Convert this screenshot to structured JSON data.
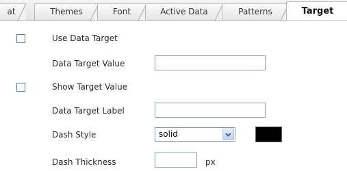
{
  "tabs": [
    {
      "label": "at"
    },
    {
      "label": "Themes"
    },
    {
      "label": "Font"
    },
    {
      "label": "Active Data"
    },
    {
      "label": "Patterns"
    },
    {
      "label": "Target"
    }
  ],
  "active_tab": "Target",
  "form": {
    "use_data_target": {
      "label": "Use Data Target",
      "checked": false
    },
    "data_target_value": {
      "label": "Data Target Value",
      "value": ""
    },
    "show_target_value": {
      "label": "Show Target Value",
      "checked": false
    },
    "data_target_label": {
      "label": "Data Target Label",
      "value": ""
    },
    "dash_style": {
      "label": "Dash Style",
      "value": "solid",
      "color": "#000000"
    },
    "dash_thickness": {
      "label": "Dash Thickness",
      "value": "",
      "unit": "px"
    }
  }
}
